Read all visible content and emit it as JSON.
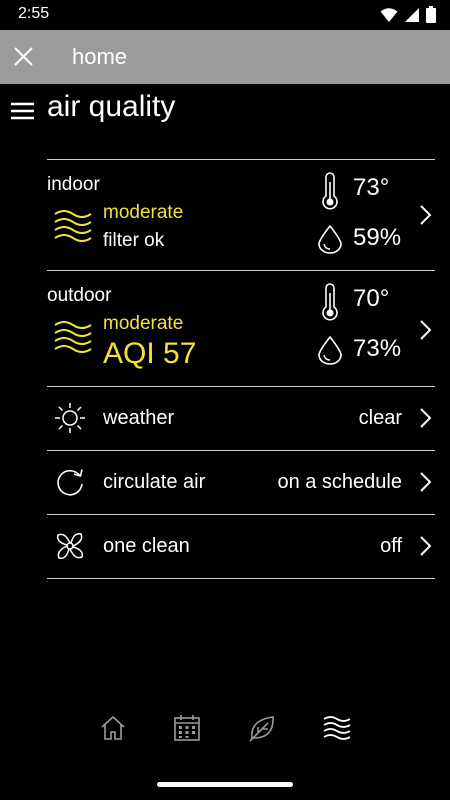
{
  "status_bar": {
    "time": "2:55",
    "icons": [
      "wifi-icon",
      "signal-icon",
      "battery-icon"
    ]
  },
  "app_bar": {
    "title": "home",
    "close_icon": "close-icon"
  },
  "page": {
    "title": "air quality",
    "menu_icon": "menu-icon"
  },
  "colors": {
    "accent": "#f1e13f",
    "divider": "#cfcfcf",
    "app_bar_bg": "#9b9b9b"
  },
  "indoor": {
    "label": "indoor",
    "status": "moderate",
    "detail": "filter ok",
    "temperature": "73°",
    "humidity": "59%"
  },
  "outdoor": {
    "label": "outdoor",
    "status": "moderate",
    "detail": "AQI 57",
    "temperature": "70°",
    "humidity": "73%"
  },
  "rows": [
    {
      "label": "weather",
      "value": "clear",
      "icon": "sun-icon"
    },
    {
      "label": "circulate air",
      "value": "on a schedule",
      "icon": "circulate-icon"
    },
    {
      "label": "one clean",
      "value": "off",
      "icon": "fan-icon"
    }
  ],
  "bottom_nav": [
    {
      "icon": "home-icon"
    },
    {
      "icon": "calendar-icon"
    },
    {
      "icon": "leaf-icon"
    },
    {
      "icon": "air-quality-icon",
      "active": true
    }
  ]
}
